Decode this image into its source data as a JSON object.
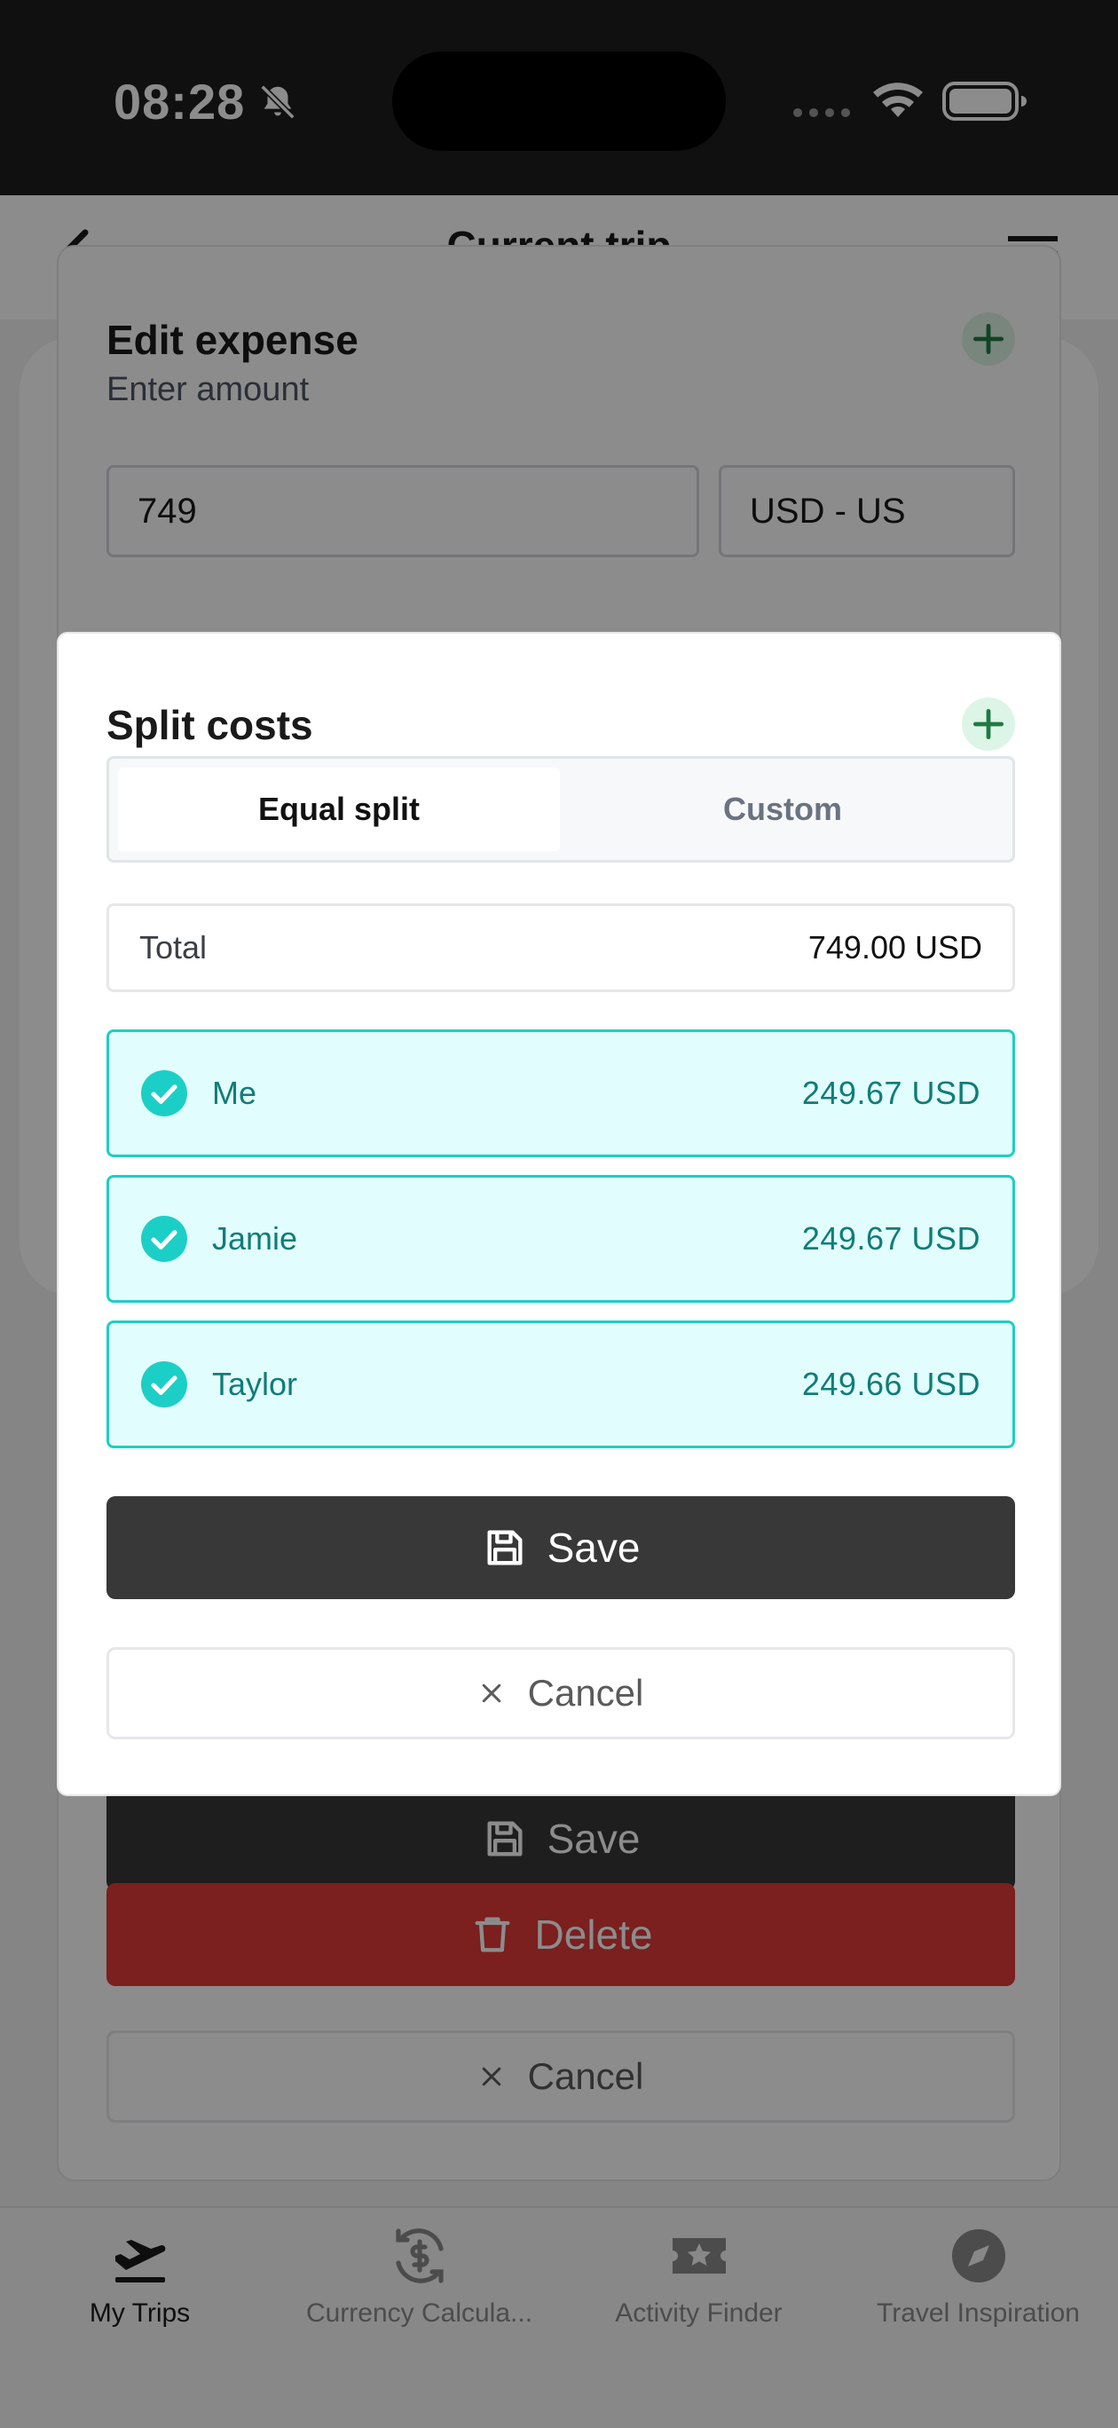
{
  "status_bar": {
    "time": "08:28"
  },
  "header": {
    "title": "Current trip"
  },
  "edit_expense": {
    "title": "Edit expense",
    "subtitle": "Enter amount",
    "amount_value": "749",
    "currency_value": "USD - US",
    "save_label": "Save",
    "delete_label": "Delete",
    "cancel_label": "Cancel"
  },
  "split_costs": {
    "title": "Split costs",
    "tabs": [
      {
        "label": "Equal split",
        "active": true
      },
      {
        "label": "Custom",
        "active": false
      }
    ],
    "total_label": "Total",
    "total_value": "749.00 USD",
    "participants": [
      {
        "name": "Me",
        "amount": "249.67 USD",
        "selected": true
      },
      {
        "name": "Jamie",
        "amount": "249.67 USD",
        "selected": true
      },
      {
        "name": "Taylor",
        "amount": "249.66 USD",
        "selected": true
      }
    ],
    "save_label": "Save",
    "cancel_label": "Cancel"
  },
  "tab_bar": {
    "items": [
      {
        "label": "My Trips",
        "icon": "plane-icon",
        "active": true
      },
      {
        "label": "Currency Calcula...",
        "icon": "currency-exchange-icon",
        "active": false
      },
      {
        "label": "Activity Finder",
        "icon": "ticket-star-icon",
        "active": false
      },
      {
        "label": "Travel Inspiration",
        "icon": "compass-icon",
        "active": false
      }
    ]
  },
  "colors": {
    "accent_teal": "#1ccfc6",
    "row_bg": "#e2fdfd",
    "row_text": "#0e7d79",
    "primary_dark": "#383838",
    "danger": "#e03a3a",
    "plus_green": "#1f7a44"
  }
}
